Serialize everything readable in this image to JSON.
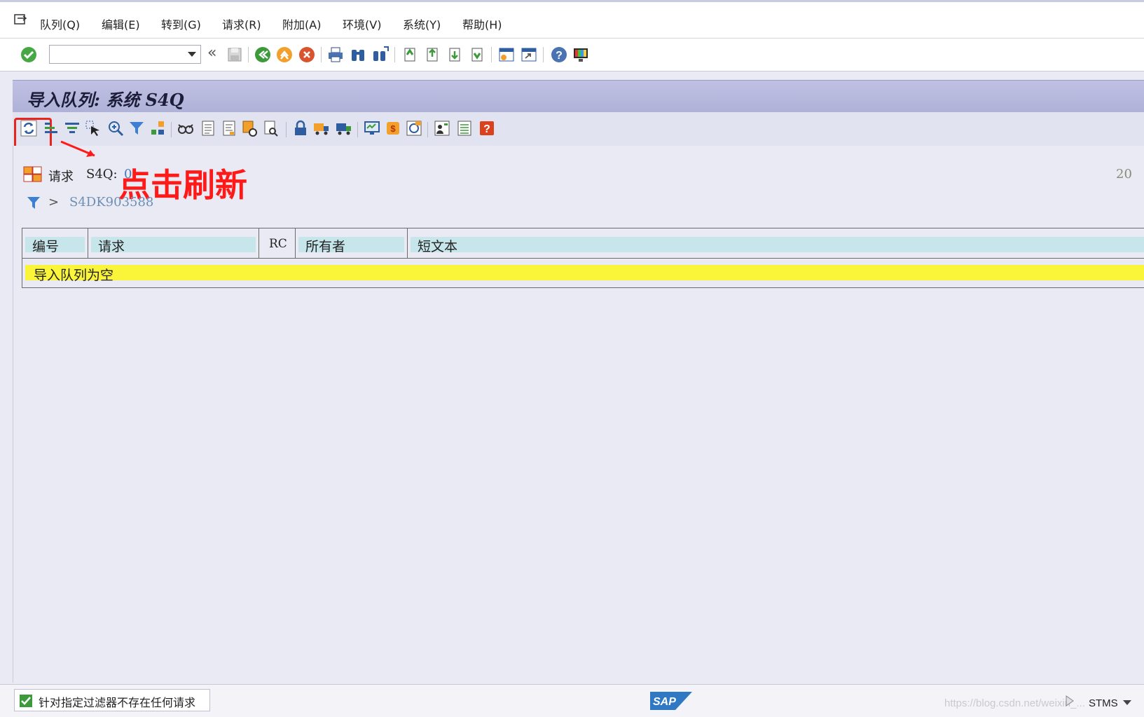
{
  "menu": {
    "items": [
      "队列(Q)",
      "编辑(E)",
      "转到(G)",
      "请求(R)",
      "附加(A)",
      "环境(V)",
      "系统(Y)",
      "帮助(H)"
    ]
  },
  "toolbar": {
    "command_value": "",
    "icons": [
      "enter-check-icon",
      "back-icon",
      "save-icon",
      "green-back-icon",
      "exit-icon",
      "cancel-icon",
      "print-icon",
      "find-icon",
      "find-next-icon",
      "first-page-icon",
      "prev-page-icon",
      "next-page-icon",
      "last-page-icon",
      "new-session-icon",
      "shortcut-icon",
      "help-icon",
      "customize-layout-icon"
    ]
  },
  "title": "导入队列: 系统 S4Q",
  "request_line": {
    "label": "请求",
    "system": "S4Q:",
    "count": "0",
    "right_value": "20"
  },
  "filter": {
    "value": "S4DK903588"
  },
  "annotation": {
    "text": "点击刷新",
    "color": "#ff1a1a"
  },
  "table": {
    "headers": [
      "编号",
      "请求",
      "RC",
      "所有者",
      "短文本"
    ],
    "empty_message": "导入队列为空"
  },
  "status": {
    "text": "针对指定过滤器不存在任何请求",
    "tcode": "STMS",
    "watermark": "https://blog.csdn.net/weixin_..."
  },
  "colors": {
    "title_bar": "#b0b1d8",
    "header_fill": "#c7e6ec",
    "empty_row": "#fbf53a",
    "background": "#e9eaf3"
  }
}
